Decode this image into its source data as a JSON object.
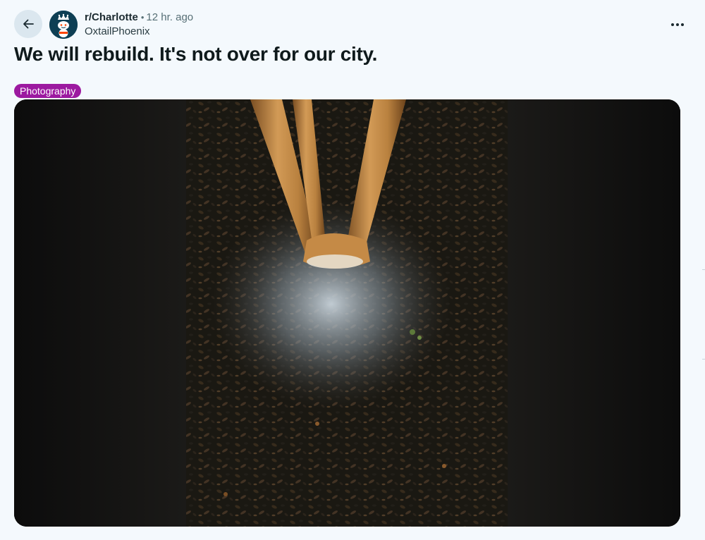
{
  "post": {
    "subreddit": "r/Charlotte",
    "separator": "•",
    "age": "12 hr. ago",
    "author": "OxtailPhoenix",
    "title": "We will rebuild. It's not over for our city.",
    "flair": {
      "label": "Photography",
      "color": "#9c1aa0"
    },
    "image": {
      "description": "Night photo of a multi-trunk tree base lit by flash on dark mulch",
      "icon": "photo-icon"
    }
  },
  "icons": {
    "back": "back-arrow-icon",
    "subreddit_avatar": "snoo-avatar-icon",
    "more": "more-horizontal-icon"
  },
  "colors": {
    "background": "#f4f9fd",
    "text": "#0f1a1c",
    "muted": "#576f76",
    "back_button_bg": "#dbe7ef",
    "avatar_bg": "#0e3f54"
  }
}
